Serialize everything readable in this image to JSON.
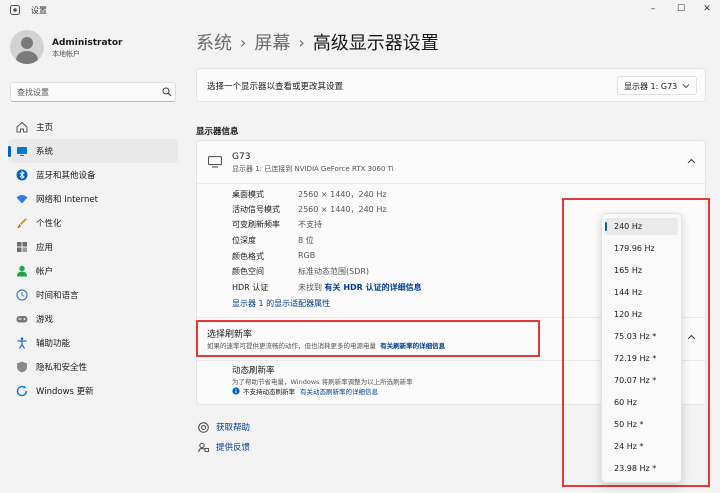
{
  "app": {
    "title": "设置"
  },
  "window": {
    "minimize": "–",
    "maximize": "☐",
    "close": "✕"
  },
  "user": {
    "name": "Administrator",
    "type": "本地帐户"
  },
  "search": {
    "placeholder": "查找设置"
  },
  "sidebar": {
    "items": [
      {
        "label": "主页",
        "icon": "home-icon"
      },
      {
        "label": "系统",
        "icon": "system-icon",
        "active": true
      },
      {
        "label": "蓝牙和其他设备",
        "icon": "bluetooth-icon"
      },
      {
        "label": "网络和 Internet",
        "icon": "wifi-icon"
      },
      {
        "label": "个性化",
        "icon": "brush-icon"
      },
      {
        "label": "应用",
        "icon": "apps-icon"
      },
      {
        "label": "帐户",
        "icon": "account-icon"
      },
      {
        "label": "时间和语言",
        "icon": "globe-clock-icon"
      },
      {
        "label": "游戏",
        "icon": "gamepad-icon"
      },
      {
        "label": "辅助功能",
        "icon": "accessibility-icon"
      },
      {
        "label": "隐私和安全性",
        "icon": "shield-icon"
      },
      {
        "label": "Windows 更新",
        "icon": "update-icon"
      }
    ]
  },
  "breadcrumb": {
    "items": [
      "系统",
      "屏幕",
      "高级显示器设置"
    ],
    "separator": "›"
  },
  "display_select": {
    "label": "选择一个显示器以查看或更改其设置",
    "value": "显示器 1: G73"
  },
  "display_info": {
    "section_title": "显示器信息",
    "monitor_name": "G73",
    "monitor_sub": "显示器 1: 已连接到 NVIDIA GeForce RTX 3060 Ti",
    "props": [
      {
        "label": "桌面模式",
        "value": "2560 × 1440，240 Hz"
      },
      {
        "label": "活动信号模式",
        "value": "2560 × 1440，240 Hz"
      },
      {
        "label": "可变刷新频率",
        "value": "不支持"
      },
      {
        "label": "位深度",
        "value": "8 位"
      },
      {
        "label": "颜色格式",
        "value": "RGB"
      },
      {
        "label": "颜色空间",
        "value": "标准动态范围(SDR)"
      },
      {
        "label": "HDR 认证",
        "value": "未找到",
        "link": "有关 HDR 认证的详细信息"
      }
    ],
    "adapter_link": "显示器 1 的显示适配器属性"
  },
  "refresh_rate": {
    "title": "选择刷新率",
    "desc": "如果的速率可提供更流畅的动作，但也消耗更多的电源电量",
    "desc_link": "有关刷新率的详细信息",
    "dynamic_title": "动态刷新率",
    "dynamic_desc": "为了帮助节省电量，Windows 将刷新率调整为以上所选刷新率",
    "dynamic_status": "不支持动态刷新率",
    "dynamic_link": "有关动态刷新率的详细信息",
    "options": [
      "240 Hz",
      "179.96 Hz",
      "165 Hz",
      "144 Hz",
      "120 Hz",
      "75.03 Hz *",
      "72.19 Hz *",
      "70.07 Hz *",
      "60 Hz",
      "50 Hz *",
      "24 Hz *",
      "23.98 Hz *"
    ],
    "selected": "240 Hz"
  },
  "help": {
    "get_help": "获取帮助",
    "feedback": "提供反馈"
  },
  "colors": {
    "accent": "#005fb8",
    "link": "#003e92",
    "highlight": "#e53935"
  }
}
